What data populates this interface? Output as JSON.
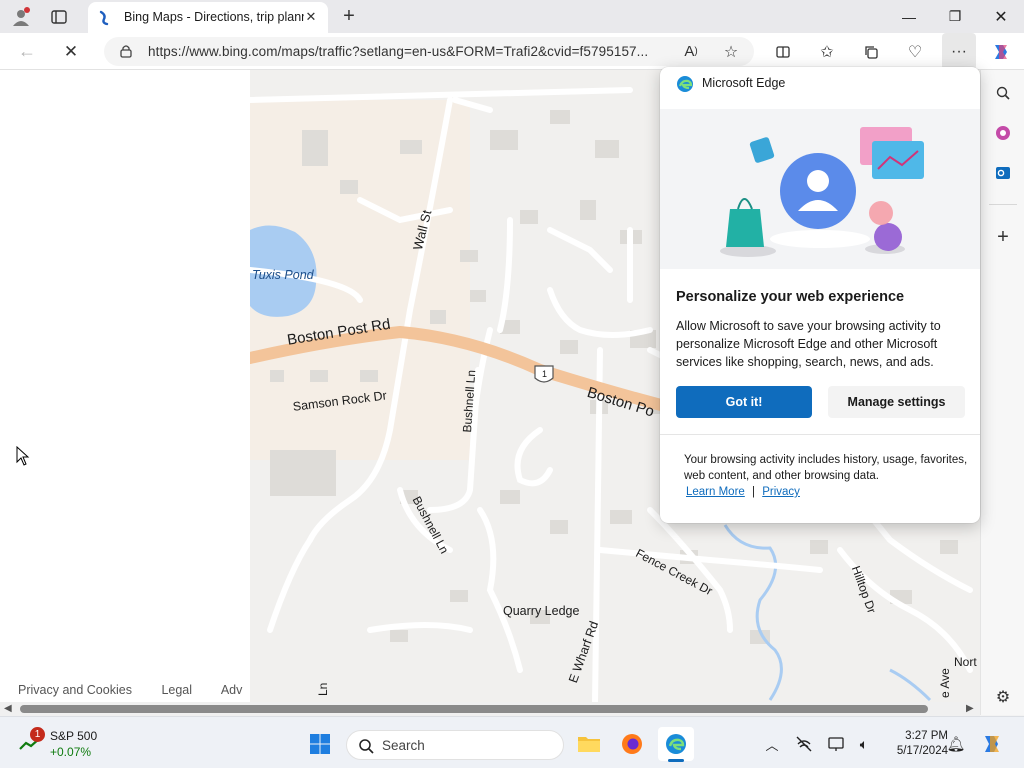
{
  "browser": {
    "tab_title": "Bing Maps - Directions, trip planner",
    "url": "https://www.bing.com/maps/traffic?setlang=en-us&FORM=Trafi2&cvid=f5795157..."
  },
  "left_panel": {
    "footer_links": [
      "Privacy and Cookies",
      "Legal",
      "Adv"
    ]
  },
  "map": {
    "labels": {
      "tuxis_pond": "Tuxis Pond",
      "boston_post_rd_1": "Boston Post Rd",
      "boston_post_rd_2": "Boston Po",
      "wall_st": "Wall St",
      "samson_rock": "Samson Rock Dr",
      "bushnell_ln_1": "Bushnell Ln",
      "bushnell_ln_2": "Bushnell Ln",
      "fence_creek": "Fence Creek Dr",
      "quarry_ledge": "Quarry Ledge",
      "e_wharf": "E Wharf Rd",
      "hilltop": "Hilltop Dr",
      "north": "Nort",
      "ave": "e Ave",
      "ln": "Ln",
      "route": "1"
    }
  },
  "popup": {
    "header": "Microsoft Edge",
    "heading": "Personalize your web experience",
    "body": "Allow Microsoft to save your browsing activity to personalize Microsoft Edge and other Microsoft services like shopping, search, news, and ads.",
    "primary_button": "Got it!",
    "secondary_button": "Manage settings",
    "note": "Your browsing activity includes history, usage, favorites, web content, and other browsing data.",
    "link_learn_more": "Learn More",
    "link_separator": "|",
    "link_privacy": "Privacy"
  },
  "taskbar": {
    "stock_name": "S&P 500",
    "stock_change": "+0.07%",
    "stock_badge": "1",
    "search_placeholder": "Search",
    "time": "3:27 PM",
    "date": "5/17/2024"
  },
  "colors": {
    "accent": "#0f6cbd",
    "road_major": "#f3c49a",
    "water": "#a9ccf2",
    "stock_up": "#107c10"
  }
}
